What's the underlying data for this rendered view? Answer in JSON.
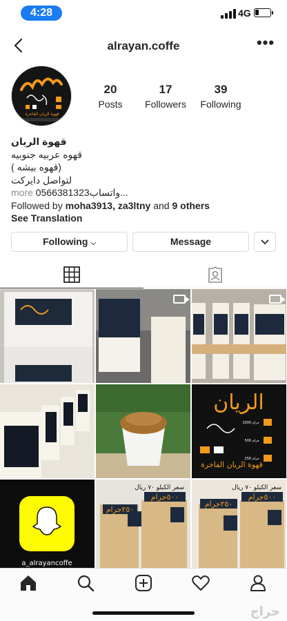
{
  "status": {
    "time": "4:28",
    "network": "4G"
  },
  "header": {
    "username": "alrayan.coffe"
  },
  "stats": [
    {
      "number": "20",
      "label": "Posts"
    },
    {
      "number": "17",
      "label": "Followers"
    },
    {
      "number": "39",
      "label": "Following"
    }
  ],
  "bio": {
    "name": "قهوة الريان",
    "line1": "قهوه عربيه جنوبيه",
    "line2": "( قهوه بيشه)",
    "line3": "لتواصل دايركت",
    "line4": "واتساب0566381323...",
    "more": "more",
    "followed_by_prefix": "Followed by",
    "followed_by_users": "moha3913, za3ltny",
    "followed_by_and": "and",
    "followed_by_others": "9 others",
    "see_translation": "See Translation"
  },
  "buttons": {
    "following": "Following",
    "message": "Message"
  },
  "brand": {
    "name_ar": "الريان",
    "tagline_ar": "قهوة الريان الفاخرة",
    "handle": "a_alrayancoffe"
  },
  "grid_text": {
    "price_line": "سعر الكيلو ٧٠ ريال",
    "label_500": "٥٠٠جرام",
    "label_250": "٢٥٠جرام",
    "sizes": [
      "جرام 1000",
      "جرام 500",
      "جرام 250"
    ]
  },
  "watermark": "حراج",
  "colors": {
    "accent": "#1a7cf2",
    "border": "#dbdbdb",
    "orange": "#f39a1e"
  }
}
